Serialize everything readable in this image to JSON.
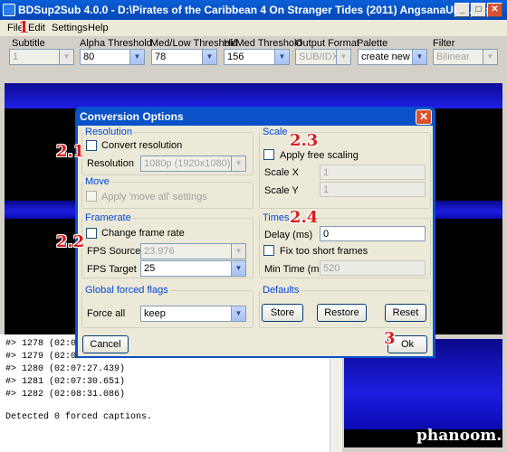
{
  "window": {
    "title": "BDSup2Sub 4.0.0 - D:\\Pirates of the Caribbean 4 On Stranger Tides (2011) AngsanaUPC.sup",
    "minimize": "_",
    "maximize": "□",
    "close": "✕"
  },
  "menu": {
    "file": "File",
    "edit": "Edit",
    "settings": "Settings",
    "help": "Help"
  },
  "toolbar": {
    "subtitle_label": "Subtitle",
    "subtitle_value": "1",
    "alpha_label": "Alpha Threshold",
    "alpha_value": "80",
    "medlow_label": "Med/Low Threshold",
    "medlow_value": "78",
    "himed_label": "Hi/Med Threshold",
    "himed_value": "156",
    "output_label": "Output Format",
    "output_value": "SUB/IDX",
    "palette_label": "Palette",
    "palette_value": "create new",
    "filter_label": "Filter",
    "filter_value": "Bilinear"
  },
  "dialog": {
    "title": "Conversion Options",
    "close": "✕",
    "resolution": {
      "group": "Resolution",
      "convert": "Convert resolution",
      "label": "Resolution",
      "value": "1080p (1920x1080)"
    },
    "move": {
      "group": "Move",
      "apply": "Apply 'move all' settings"
    },
    "framerate": {
      "group": "Framerate",
      "change": "Change frame rate",
      "source_label": "FPS Source",
      "source_value": "23.976",
      "target_label": "FPS Target",
      "target_value": "25"
    },
    "forced": {
      "group": "Global forced flags",
      "label": "Force all",
      "value": "keep"
    },
    "scale": {
      "group": "Scale",
      "apply": "Apply free scaling",
      "x_label": "Scale X",
      "x_value": "1",
      "y_label": "Scale Y",
      "y_value": "1"
    },
    "times": {
      "group": "Times",
      "delay_label": "Delay (ms)",
      "delay_value": "0",
      "fix": "Fix too short frames",
      "min_label": "Min Time (ms)",
      "min_value": "520"
    },
    "defaults": {
      "group": "Defaults",
      "store": "Store",
      "restore": "Restore",
      "reset": "Reset"
    },
    "cancel": "Cancel",
    "ok": "Ok"
  },
  "annotations": {
    "a1": "1",
    "a21": "2.1",
    "a22": "2.2",
    "a23": "2.3",
    "a24": "2.4",
    "a3": "3"
  },
  "log": {
    "lines": [
      "#> 1278 (02:07",
      "#> 1279 (02:07",
      "#> 1280 (02:07:27.439)",
      "#> 1281 (02:07:30.651)",
      "#> 1282 (02:08:31.086)",
      "Detected 0 forced captions."
    ]
  },
  "watermark": "phanoom."
}
